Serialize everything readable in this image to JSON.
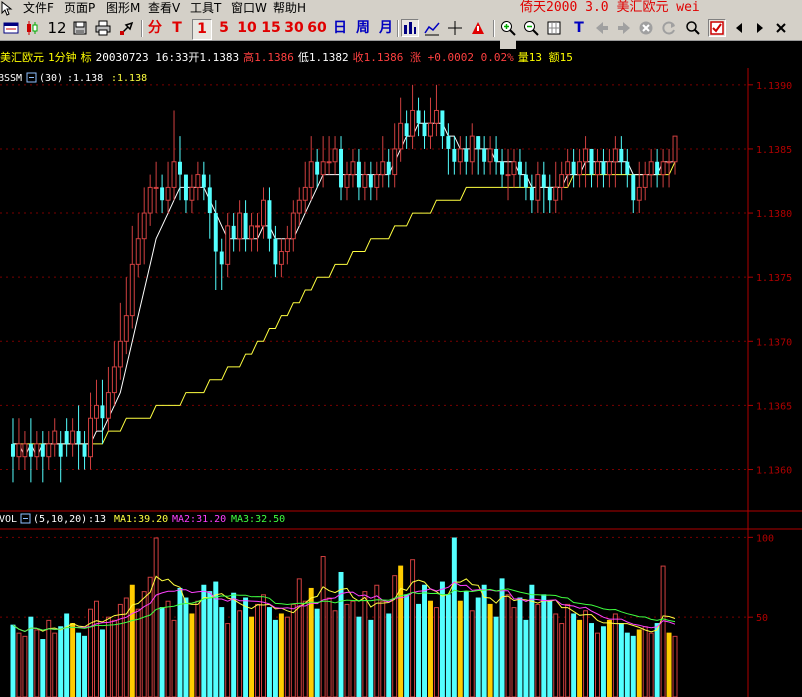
{
  "menubar": {
    "items": [
      "文件F",
      "页面P",
      "图形M",
      "查看V",
      "工具T",
      "窗口W",
      "帮助H"
    ],
    "app_title": "倚天2000 3.0 美汇欧元 wei"
  },
  "toolbar": {
    "count_label": "12",
    "period_fen": "分",
    "period_t": "T",
    "period_buttons": [
      "1",
      "5",
      "10",
      "15",
      "30",
      "60"
    ],
    "period_day": "日",
    "period_week": "周",
    "period_month": "月",
    "font_t": "T"
  },
  "infobar": {
    "symbol": "美汇欧元",
    "period": "1分钟",
    "mark": "标",
    "date": "20030723",
    "time": "16:33",
    "open": "开1.1383",
    "high": "高1.1386",
    "low": "低1.1382",
    "close": "收1.1386",
    "change_word": "涨",
    "change": "+0.0002",
    "change_pct": "0.02%",
    "volume": "量13",
    "amount": "额15"
  },
  "price_panel": {
    "indicator": "BSSM",
    "params": "(30)",
    "value_white": ":1.138",
    "value_yellow": ":1.138",
    "y_ticks": [
      "1.1390",
      "1.1385",
      "1.1380",
      "1.1375",
      "1.1370",
      "1.1365",
      "1.1360"
    ]
  },
  "volume_panel": {
    "indicator": "VOL",
    "params": "(5,10,20)",
    "value": ":13",
    "ma1": "MA1:39.20",
    "ma2": "MA2:31.20",
    "ma3": "MA3:32.50",
    "y_ticks": [
      "100",
      "50"
    ]
  },
  "colors": {
    "up": "#d04040",
    "down": "#54ffff",
    "axis": "#b00000",
    "ma_yellow": "#ffff40",
    "ma_white": "#ffffff",
    "vol_up_yellow": "#ffcc00",
    "vol_ma2": "#ff40ff",
    "vol_ma3": "#40ff40"
  },
  "chart_data": {
    "type": "candlestick",
    "x": [
      "1",
      "2",
      "3",
      "4",
      "5",
      "6",
      "7",
      "8",
      "9",
      "10",
      "11",
      "12",
      "13",
      "14",
      "15",
      "16",
      "17",
      "18",
      "19",
      "20",
      "21",
      "22",
      "23",
      "24",
      "25",
      "26",
      "27",
      "28",
      "29",
      "30",
      "31",
      "32",
      "33",
      "34",
      "35",
      "36",
      "37",
      "38",
      "39",
      "40",
      "41",
      "42",
      "43",
      "44",
      "45",
      "46",
      "47",
      "48",
      "49",
      "50",
      "51",
      "52",
      "53",
      "54",
      "55",
      "56",
      "57",
      "58",
      "59",
      "60",
      "61",
      "62",
      "63",
      "64",
      "65",
      "66",
      "67",
      "68",
      "69",
      "70",
      "71",
      "72",
      "73",
      "74",
      "75",
      "76",
      "77",
      "78",
      "79",
      "80",
      "81",
      "82",
      "83",
      "84",
      "85",
      "86",
      "87",
      "88",
      "89",
      "90",
      "91",
      "92",
      "93",
      "94",
      "95",
      "96",
      "97",
      "98",
      "99",
      "100",
      "101",
      "102",
      "103",
      "104",
      "105",
      "106",
      "107",
      "108",
      "109",
      "110",
      "111",
      "112"
    ],
    "open": [
      1.1362,
      1.1361,
      1.1361,
      1.1362,
      1.1361,
      1.1362,
      1.1361,
      1.1362,
      1.1362,
      1.1363,
      1.1362,
      1.1363,
      1.1362,
      1.1361,
      1.1364,
      1.1365,
      1.1364,
      1.1366,
      1.1368,
      1.137,
      1.1372,
      1.1376,
      1.1378,
      1.138,
      1.1382,
      1.1382,
      1.1381,
      1.1382,
      1.1384,
      1.1383,
      1.1381,
      1.1382,
      1.1383,
      1.1382,
      1.138,
      1.1377,
      1.1376,
      1.1379,
      1.1378,
      1.138,
      1.1378,
      1.1379,
      1.1379,
      1.1381,
      1.1378,
      1.1376,
      1.1377,
      1.1378,
      1.138,
      1.1381,
      1.1382,
      1.1384,
      1.1383,
      1.1384,
      1.1384,
      1.1385,
      1.1382,
      1.1383,
      1.1384,
      1.1382,
      1.1383,
      1.1382,
      1.1383,
      1.1384,
      1.1383,
      1.1385,
      1.1387,
      1.1386,
      1.1388,
      1.1387,
      1.1386,
      1.1387,
      1.1388,
      1.1386,
      1.1385,
      1.1384,
      1.1385,
      1.1384,
      1.1386,
      1.1385,
      1.1384,
      1.1385,
      1.1384,
      1.1383,
      1.1383,
      1.1384,
      1.1383,
      1.1382,
      1.1381,
      1.1383,
      1.1382,
      1.1381,
      1.1382,
      1.1383,
      1.1384,
      1.1383,
      1.1384,
      1.1385,
      1.1383,
      1.1384,
      1.1383,
      1.1384,
      1.1385,
      1.1384,
      1.1383,
      1.1381,
      1.1382,
      1.1383,
      1.1384,
      1.1383,
      1.1384,
      1.1384
    ],
    "close": [
      1.1361,
      1.1362,
      1.1362,
      1.1361,
      1.1362,
      1.1361,
      1.1362,
      1.1363,
      1.1361,
      1.1362,
      1.1363,
      1.1362,
      1.1361,
      1.1364,
      1.1365,
      1.1364,
      1.1366,
      1.1368,
      1.137,
      1.1372,
      1.1376,
      1.1378,
      1.138,
      1.1382,
      1.1382,
      1.1381,
      1.1382,
      1.1384,
      1.1383,
      1.1381,
      1.1382,
      1.1383,
      1.1382,
      1.138,
      1.1377,
      1.1376,
      1.1379,
      1.1378,
      1.138,
      1.1378,
      1.1379,
      1.1379,
      1.1381,
      1.1378,
      1.1376,
      1.1377,
      1.1378,
      1.138,
      1.1381,
      1.1382,
      1.1384,
      1.1383,
      1.1384,
      1.1384,
      1.1385,
      1.1382,
      1.1383,
      1.1384,
      1.1382,
      1.1383,
      1.1382,
      1.1383,
      1.1384,
      1.1383,
      1.1385,
      1.1387,
      1.1386,
      1.1388,
      1.1387,
      1.1386,
      1.1387,
      1.1388,
      1.1386,
      1.1385,
      1.1384,
      1.1385,
      1.1384,
      1.1386,
      1.1385,
      1.1384,
      1.1385,
      1.1384,
      1.1383,
      1.1383,
      1.1384,
      1.1383,
      1.1382,
      1.1381,
      1.1383,
      1.1382,
      1.1381,
      1.1382,
      1.1383,
      1.1384,
      1.1383,
      1.1384,
      1.1385,
      1.1383,
      1.1384,
      1.1383,
      1.1384,
      1.1385,
      1.1384,
      1.1383,
      1.1381,
      1.1382,
      1.1383,
      1.1384,
      1.1383,
      1.1384,
      1.1384,
      1.1386
    ],
    "high": [
      1.1364,
      1.1364,
      1.1363,
      1.1364,
      1.1363,
      1.1363,
      1.1363,
      1.1364,
      1.1363,
      1.1364,
      1.1364,
      1.1365,
      1.1363,
      1.1366,
      1.1367,
      1.1367,
      1.1368,
      1.137,
      1.1373,
      1.1375,
      1.1379,
      1.138,
      1.1382,
      1.1383,
      1.1384,
      1.1383,
      1.1384,
      1.1388,
      1.1386,
      1.1383,
      1.1383,
      1.1384,
      1.1384,
      1.1383,
      1.1381,
      1.1378,
      1.138,
      1.138,
      1.1381,
      1.1381,
      1.138,
      1.138,
      1.1382,
      1.1382,
      1.1379,
      1.1378,
      1.1379,
      1.1381,
      1.1382,
      1.1384,
      1.1386,
      1.1385,
      1.1386,
      1.1386,
      1.1386,
      1.1386,
      1.1384,
      1.1385,
      1.1385,
      1.1384,
      1.1384,
      1.1384,
      1.1386,
      1.1385,
      1.1387,
      1.1389,
      1.1388,
      1.139,
      1.1389,
      1.1388,
      1.1389,
      1.139,
      1.1388,
      1.1387,
      1.1386,
      1.1386,
      1.1386,
      1.1387,
      1.1386,
      1.1386,
      1.1386,
      1.1386,
      1.1385,
      1.1385,
      1.1385,
      1.1385,
      1.1384,
      1.1383,
      1.1384,
      1.1384,
      1.1383,
      1.1384,
      1.1384,
      1.1385,
      1.1385,
      1.1385,
      1.1386,
      1.1385,
      1.1385,
      1.1385,
      1.1385,
      1.1386,
      1.1386,
      1.1385,
      1.1383,
      1.1384,
      1.1384,
      1.1385,
      1.1385,
      1.1385,
      1.1385,
      1.1386
    ],
    "low": [
      1.1359,
      1.136,
      1.136,
      1.1359,
      1.136,
      1.1359,
      1.136,
      1.1361,
      1.1359,
      1.1361,
      1.1361,
      1.136,
      1.136,
      1.136,
      1.1363,
      1.1362,
      1.1363,
      1.1365,
      1.1367,
      1.1369,
      1.1371,
      1.1375,
      1.1376,
      1.1379,
      1.138,
      1.138,
      1.138,
      1.1381,
      1.1381,
      1.138,
      1.138,
      1.1381,
      1.1381,
      1.1378,
      1.1374,
      1.1374,
      1.1375,
      1.1377,
      1.1377,
      1.1377,
      1.1377,
      1.1377,
      1.1378,
      1.1377,
      1.1375,
      1.1375,
      1.1376,
      1.1377,
      1.1379,
      1.138,
      1.1381,
      1.1382,
      1.1382,
      1.1383,
      1.1383,
      1.1381,
      1.1381,
      1.1382,
      1.1381,
      1.1381,
      1.1381,
      1.1381,
      1.1382,
      1.1382,
      1.1382,
      1.1384,
      1.1385,
      1.1385,
      1.1386,
      1.1385,
      1.1385,
      1.1386,
      1.1385,
      1.1383,
      1.1383,
      1.1383,
      1.1383,
      1.1383,
      1.1383,
      1.1383,
      1.1383,
      1.1383,
      1.1382,
      1.1381,
      1.1382,
      1.1382,
      1.1381,
      1.138,
      1.138,
      1.138,
      1.138,
      1.138,
      1.1381,
      1.1382,
      1.1382,
      1.1382,
      1.1382,
      1.1382,
      1.1382,
      1.1382,
      1.1382,
      1.1382,
      1.1383,
      1.1382,
      1.138,
      1.138,
      1.1381,
      1.1382,
      1.1382,
      1.1382,
      1.1382,
      1.1383
    ],
    "ma_white_values": [
      1.1362,
      1.1362,
      1.1361,
      1.1362,
      1.1361,
      1.1362,
      1.1362,
      1.1362,
      1.1362,
      1.1362,
      1.1362,
      1.1362,
      1.1362,
      1.1362,
      1.1363,
      1.1363,
      1.1364,
      1.1365,
      1.1366,
      1.1368,
      1.137,
      1.1372,
      1.1374,
      1.1376,
      1.1378,
      1.1379,
      1.138,
      1.1381,
      1.1382,
      1.1382,
      1.1382,
      1.1382,
      1.1382,
      1.1381,
      1.138,
      1.1379,
      1.1378,
      1.1378,
      1.1378,
      1.1378,
      1.1378,
      1.1378,
      1.1379,
      1.1379,
      1.1378,
      1.1378,
      1.1378,
      1.1378,
      1.1379,
      1.138,
      1.1381,
      1.1382,
      1.1383,
      1.1383,
      1.1383,
      1.1383,
      1.1383,
      1.1383,
      1.1383,
      1.1383,
      1.1383,
      1.1383,
      1.1383,
      1.1383,
      1.1384,
      1.1385,
      1.1386,
      1.1386,
      1.1387,
      1.1387,
      1.1387,
      1.1387,
      1.1387,
      1.1386,
      1.1386,
      1.1385,
      1.1385,
      1.1385,
      1.1385,
      1.1385,
      1.1385,
      1.1384,
      1.1384,
      1.1384,
      1.1384,
      1.1383,
      1.1383,
      1.1382,
      1.1382,
      1.1382,
      1.1382,
      1.1382,
      1.1382,
      1.1383,
      1.1383,
      1.1383,
      1.1384,
      1.1384,
      1.1384,
      1.1384,
      1.1384,
      1.1384,
      1.1384,
      1.1384,
      1.1383,
      1.1383,
      1.1383,
      1.1383,
      1.1383,
      1.1384,
      1.1384,
      1.1384
    ],
    "ma_yellow_values": [
      1.1362,
      1.1362,
      1.1362,
      1.1362,
      1.1362,
      1.1362,
      1.1362,
      1.1362,
      1.1362,
      1.1362,
      1.1362,
      1.1362,
      1.1362,
      1.1362,
      1.1362,
      1.1362,
      1.1363,
      1.1363,
      1.1363,
      1.1364,
      1.1364,
      1.1364,
      1.1364,
      1.1364,
      1.1365,
      1.1365,
      1.1365,
      1.1365,
      1.1365,
      1.1366,
      1.1366,
      1.1366,
      1.1366,
      1.1367,
      1.1367,
      1.1367,
      1.1368,
      1.1368,
      1.1368,
      1.1369,
      1.1369,
      1.137,
      1.137,
      1.1371,
      1.1371,
      1.1372,
      1.1372,
      1.1373,
      1.1373,
      1.1374,
      1.1374,
      1.1375,
      1.1375,
      1.1375,
      1.1376,
      1.1376,
      1.1376,
      1.1377,
      1.1377,
      1.1377,
      1.1378,
      1.1378,
      1.1378,
      1.1378,
      1.1379,
      1.1379,
      1.1379,
      1.138,
      1.138,
      1.138,
      1.138,
      1.1381,
      1.1381,
      1.1381,
      1.1381,
      1.1381,
      1.1382,
      1.1382,
      1.1382,
      1.1382,
      1.1382,
      1.1382,
      1.1382,
      1.1382,
      1.1382,
      1.1382,
      1.1382,
      1.1382,
      1.1382,
      1.1382,
      1.1382,
      1.1382,
      1.1382,
      1.1382,
      1.1383,
      1.1383,
      1.1383,
      1.1383,
      1.1383,
      1.1383,
      1.1383,
      1.1383,
      1.1383,
      1.1383,
      1.1383,
      1.1383,
      1.1383,
      1.1383,
      1.1383,
      1.1383,
      1.1383,
      1.1384
    ],
    "volume": [
      45,
      40,
      38,
      50,
      42,
      36,
      48,
      40,
      44,
      52,
      46,
      40,
      38,
      55,
      60,
      42,
      50,
      48,
      58,
      62,
      70,
      55,
      66,
      75,
      112,
      56,
      60,
      48,
      68,
      62,
      52,
      60,
      70,
      66,
      72,
      56,
      46,
      65,
      54,
      62,
      50,
      58,
      64,
      56,
      48,
      52,
      50,
      58,
      74,
      60,
      68,
      55,
      88,
      62,
      54,
      78,
      58,
      60,
      50,
      66,
      48,
      70,
      60,
      52,
      76,
      82,
      64,
      86,
      58,
      70,
      60,
      56,
      72,
      64,
      108,
      60,
      66,
      54,
      62,
      70,
      58,
      50,
      74,
      64,
      56,
      62,
      48,
      70,
      58,
      64,
      60,
      52,
      46,
      58,
      52,
      48,
      54,
      46,
      40,
      44,
      48,
      52,
      46,
      40,
      38,
      42,
      44,
      40,
      46,
      82,
      40,
      38
    ],
    "xlabel": "",
    "ylabel": "",
    "ylim": [
      1.1357,
      1.1391
    ]
  }
}
